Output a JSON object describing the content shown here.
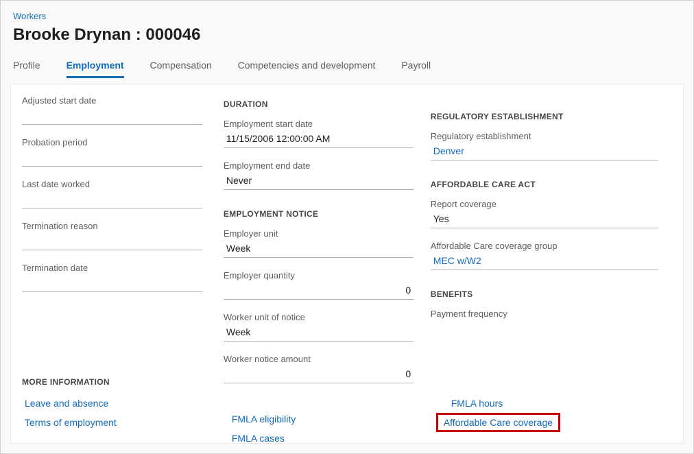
{
  "breadcrumb": "Workers",
  "page_title": "Brooke Drynan : 000046",
  "tabs": {
    "profile": "Profile",
    "employment": "Employment",
    "compensation": "Compensation",
    "competencies": "Competencies and development",
    "payroll": "Payroll"
  },
  "col1": {
    "adjusted_start_label": "Adjusted start date",
    "adjusted_start_value": "",
    "probation_label": "Probation period",
    "probation_value": "",
    "last_date_label": "Last date worked",
    "last_date_value": "",
    "termination_reason_label": "Termination reason",
    "termination_reason_value": "",
    "termination_date_label": "Termination date",
    "termination_date_value": ""
  },
  "col2": {
    "duration_title": "DURATION",
    "emp_start_label": "Employment start date",
    "emp_start_value": "11/15/2006 12:00:00 AM",
    "emp_end_label": "Employment end date",
    "emp_end_value": "Never",
    "notice_title": "EMPLOYMENT NOTICE",
    "employer_unit_label": "Employer unit",
    "employer_unit_value": "Week",
    "employer_qty_label": "Employer quantity",
    "employer_qty_value": "0",
    "worker_unit_label": "Worker unit of notice",
    "worker_unit_value": "Week",
    "worker_amt_label": "Worker notice amount",
    "worker_amt_value": "0"
  },
  "col3": {
    "reg_title": "REGULATORY ESTABLISHMENT",
    "reg_label": "Regulatory establishment",
    "reg_value": "Denver",
    "aca_title": "AFFORDABLE CARE ACT",
    "report_label": "Report coverage",
    "report_value": "Yes",
    "aca_group_label": "Affordable Care coverage group",
    "aca_group_value": "MEC w/W2",
    "benefits_title": "BENEFITS",
    "payment_freq_label": "Payment frequency",
    "payment_freq_value": ""
  },
  "more_info": {
    "title": "MORE INFORMATION",
    "leave": "Leave and absence",
    "terms": "Terms of employment",
    "fmla_elig": "FMLA eligibility",
    "fmla_cases": "FMLA cases",
    "fmla_hours": "FMLA hours",
    "aca_coverage": "Affordable Care coverage"
  }
}
